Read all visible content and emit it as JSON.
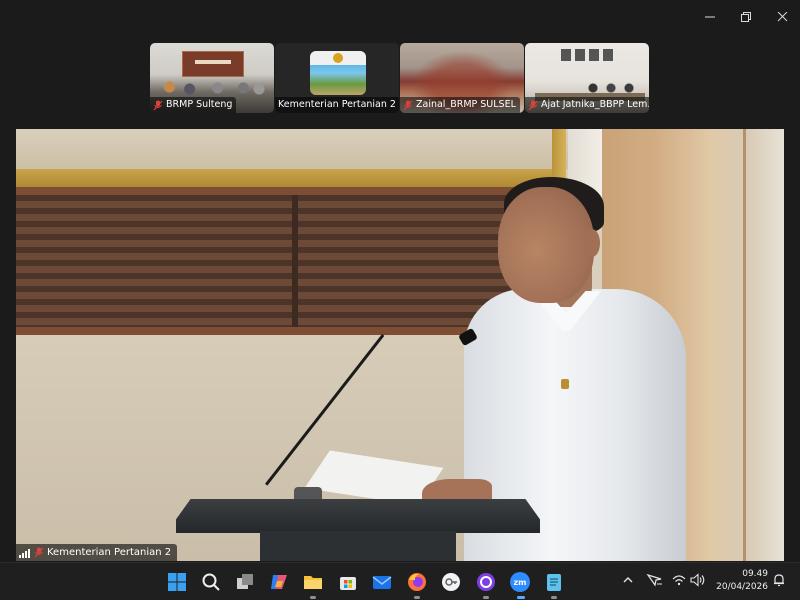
{
  "window": {
    "minimize_glyph": "—",
    "close_glyph": "✕"
  },
  "participants": [
    {
      "name": "BRMP Sulteng",
      "muted": true
    },
    {
      "name": "Kementerian Pertanian 2",
      "muted": false
    },
    {
      "name": "Zainal_BRMP SULSEL",
      "muted": true
    },
    {
      "name": "Ajat Jatnika_BBPP Lem...",
      "muted": true
    }
  ],
  "main_video": {
    "speaker_label": "Kementerian Pertanian 2",
    "muted": true
  },
  "taskbar": {
    "apps": [
      "start-icon",
      "search-icon",
      "task-view-icon",
      "copilot-icon",
      "file-explorer-icon",
      "microsoft-store-icon",
      "mail-icon",
      "firefox-icon",
      "google-meet-icon",
      "circle-app-icon",
      "zoom-icon",
      "notepad-icon"
    ],
    "zoom_label": "zm",
    "clock_time": "09.49",
    "clock_date": "20/04/2026"
  },
  "colors": {
    "accent_start": "#3aa0f0",
    "zoom": "#2d8cff",
    "mic_off": "#e0413a"
  }
}
